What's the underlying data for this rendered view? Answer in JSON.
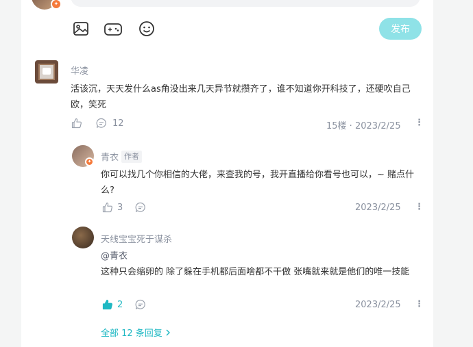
{
  "editor": {
    "publish_label": "发布",
    "tools": [
      "image-icon",
      "gamepad-icon",
      "smile-icon"
    ]
  },
  "comment": {
    "author": "华凌",
    "text": "活该沉，天天发什么as角没出来几天异节就攒齐了，谁不知道你开科技了，还硬吹自己欧，笑死",
    "like_count": "",
    "reply_count": "12",
    "floor_date": "15楼 · 2023/2/25"
  },
  "replies": [
    {
      "author": "青衣",
      "author_tag": "作者",
      "text": "你可以找几个你相信的大佬，来查我的号，我开直播给你看号也可以，~ 赌点什么?",
      "like_count": "3",
      "date": "2023/2/25"
    },
    {
      "author": "天线宝宝死于谋杀",
      "mention": "@青衣",
      "text": "这种只会缩卵的 除了躲在手机都后面啥都不干做 张嘴就来就是他们的唯一技能",
      "like_count": "2",
      "date": "2023/2/25"
    }
  ],
  "more_replies_label": "全部 12 条回复",
  "colors": {
    "accent": "#1fb8c3",
    "publish_disabled": "#8fe2e7",
    "badge": "#f57a3b"
  }
}
